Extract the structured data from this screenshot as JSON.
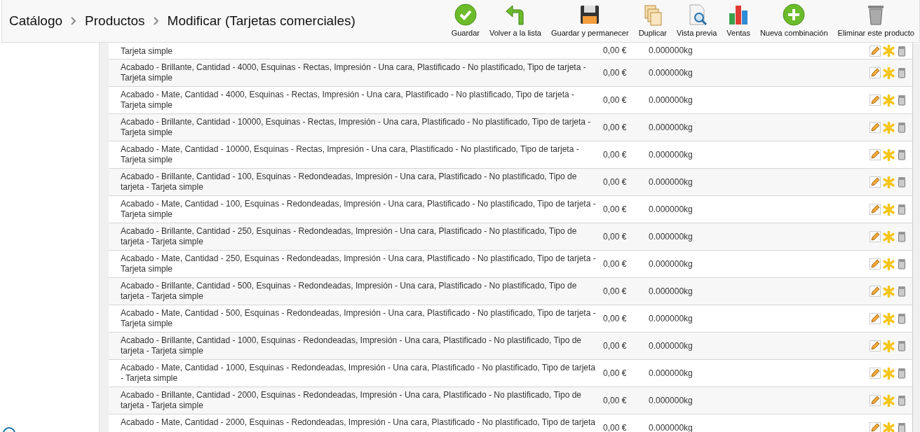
{
  "breadcrumb": [
    {
      "label": "Catálogo"
    },
    {
      "label": "Productos"
    },
    {
      "label": "Modificar (Tarjetas comerciales)"
    }
  ],
  "toolbar": [
    {
      "label": "Guardar",
      "kind": "save"
    },
    {
      "label": "Volver a la lista",
      "kind": "back"
    },
    {
      "label": "Guardar y permanecer",
      "kind": "disk"
    },
    {
      "label": "Duplicar",
      "kind": "duplicate"
    },
    {
      "label": "Vista previa",
      "kind": "preview"
    },
    {
      "label": "Ventas",
      "kind": "stats"
    },
    {
      "label": "Nueva combinación",
      "kind": "add"
    },
    {
      "label": "Eliminar este producto",
      "kind": "delete"
    }
  ],
  "rows": [
    {
      "description": "Tarjeta simple",
      "price": "0,00 €",
      "weight": "0.000000kg",
      "kind": "continued"
    },
    {
      "description": "Acabado - Brillante, Cantidad - 4000, Esquinas - Rectas, Impresión - Una cara, Plastificado - No plastificado, Tipo de tarjeta - Tarjeta simple",
      "price": "0,00 €",
      "weight": "0.000000kg"
    },
    {
      "description": "Acabado - Mate, Cantidad - 4000, Esquinas - Rectas, Impresión - Una cara, Plastificado - No plastificado, Tipo de tarjeta - Tarjeta simple",
      "price": "0,00 €",
      "weight": "0.000000kg"
    },
    {
      "description": "Acabado - Brillante, Cantidad - 10000, Esquinas - Rectas, Impresión - Una cara, Plastificado - No plastificado, Tipo de tarjeta - Tarjeta simple",
      "price": "0,00 €",
      "weight": "0.000000kg"
    },
    {
      "description": "Acabado - Mate, Cantidad - 10000, Esquinas - Rectas, Impresión - Una cara, Plastificado - No plastificado, Tipo de tarjeta - Tarjeta simple",
      "price": "0,00 €",
      "weight": "0.000000kg"
    },
    {
      "description": "Acabado - Brillante, Cantidad - 100, Esquinas - Redondeadas, Impresión - Una cara, Plastificado - No plastificado, Tipo de tarjeta - Tarjeta simple",
      "price": "0,00 €",
      "weight": "0.000000kg"
    },
    {
      "description": "Acabado - Mate, Cantidad - 100, Esquinas - Redondeadas, Impresión - Una cara, Plastificado - No plastificado, Tipo de tarjeta - Tarjeta simple",
      "price": "0,00 €",
      "weight": "0.000000kg"
    },
    {
      "description": "Acabado - Brillante, Cantidad - 250, Esquinas - Redondeadas, Impresión - Una cara, Plastificado - No plastificado, Tipo de tarjeta - Tarjeta simple",
      "price": "0,00 €",
      "weight": "0.000000kg"
    },
    {
      "description": "Acabado - Mate, Cantidad - 250, Esquinas - Redondeadas, Impresión - Una cara, Plastificado - No plastificado, Tipo de tarjeta - Tarjeta simple",
      "price": "0,00 €",
      "weight": "0.000000kg"
    },
    {
      "description": "Acabado - Brillante, Cantidad - 500, Esquinas - Redondeadas, Impresión - Una cara, Plastificado - No plastificado, Tipo de tarjeta - Tarjeta simple",
      "price": "0,00 €",
      "weight": "0.000000kg"
    },
    {
      "description": "Acabado - Mate, Cantidad - 500, Esquinas - Redondeadas, Impresión - Una cara, Plastificado - No plastificado, Tipo de tarjeta - Tarjeta simple",
      "price": "0,00 €",
      "weight": "0.000000kg"
    },
    {
      "description": "Acabado - Brillante, Cantidad - 1000, Esquinas - Redondeadas, Impresión - Una cara, Plastificado - No plastificado, Tipo de tarjeta - Tarjeta simple",
      "price": "0,00 €",
      "weight": "0.000000kg"
    },
    {
      "description": "Acabado - Mate, Cantidad - 1000, Esquinas - Redondeadas, Impresión - Una cara, Plastificado - No plastificado, Tipo de tarjeta - Tarjeta simple",
      "price": "0,00 €",
      "weight": "0.000000kg"
    },
    {
      "description": "Acabado - Brillante, Cantidad - 2000, Esquinas - Redondeadas, Impresión - Una cara, Plastificado - No plastificado, Tipo de tarjeta - Tarjeta simple",
      "price": "0,00 €",
      "weight": "0.000000kg"
    },
    {
      "description": "Acabado - Mate, Cantidad - 2000, Esquinas - Redondeadas, Impresión - Una cara, Plastificado - No plastificado, Tipo de tarjeta",
      "price": "0,00 €",
      "weight": "0.000000kg"
    }
  ]
}
